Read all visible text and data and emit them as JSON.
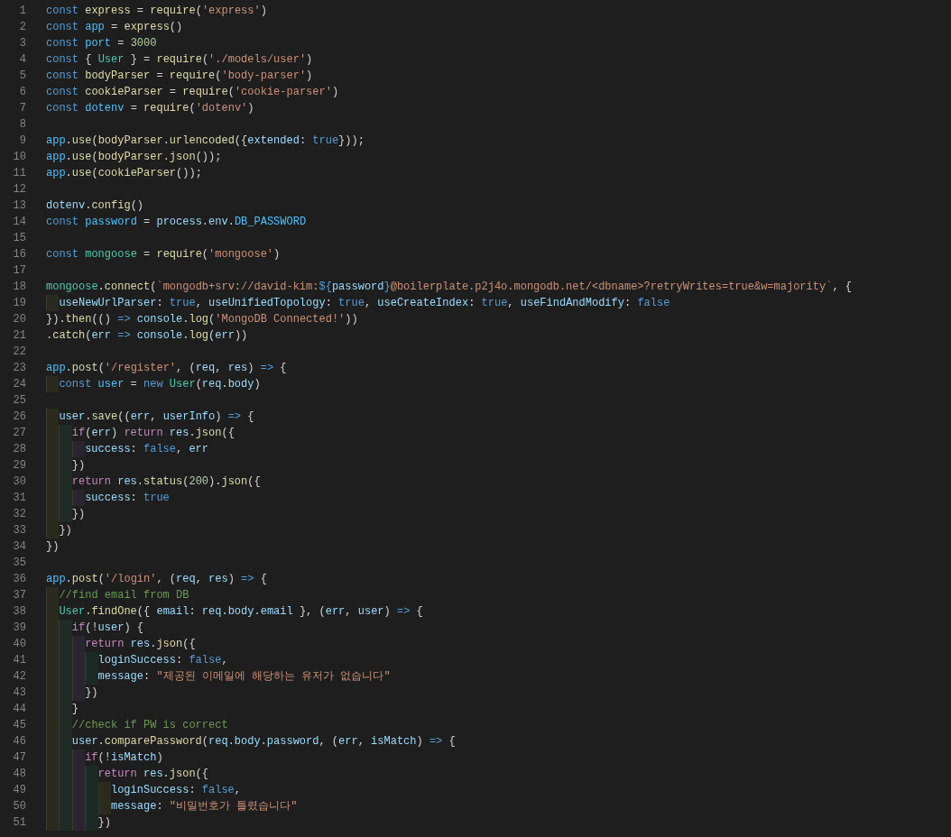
{
  "editor": {
    "lines": [
      {
        "number": "1",
        "tokens": [
          {
            "kind": "keyword",
            "text": "const "
          },
          {
            "kind": "function",
            "text": "express"
          },
          {
            "kind": "punct",
            "text": " = "
          },
          {
            "kind": "function",
            "text": "require"
          },
          {
            "kind": "punct",
            "text": "("
          },
          {
            "kind": "string",
            "text": "'express'"
          },
          {
            "kind": "punct",
            "text": ")"
          }
        ]
      },
      {
        "number": "2",
        "tokens": [
          {
            "kind": "keyword",
            "text": "const "
          },
          {
            "kind": "constant",
            "text": "app"
          },
          {
            "kind": "punct",
            "text": " = "
          },
          {
            "kind": "function",
            "text": "express"
          },
          {
            "kind": "punct",
            "text": "()"
          }
        ]
      },
      {
        "number": "3",
        "tokens": [
          {
            "kind": "keyword",
            "text": "const "
          },
          {
            "kind": "constant",
            "text": "port"
          },
          {
            "kind": "punct",
            "text": " = "
          },
          {
            "kind": "number",
            "text": "3000"
          }
        ]
      },
      {
        "number": "4",
        "tokens": [
          {
            "kind": "keyword",
            "text": "const"
          },
          {
            "kind": "punct",
            "text": " { "
          },
          {
            "kind": "type",
            "text": "User"
          },
          {
            "kind": "punct",
            "text": " } = "
          },
          {
            "kind": "function",
            "text": "require"
          },
          {
            "kind": "punct",
            "text": "("
          },
          {
            "kind": "string",
            "text": "'./models/user'"
          },
          {
            "kind": "punct",
            "text": ")"
          }
        ]
      },
      {
        "number": "5",
        "tokens": [
          {
            "kind": "keyword",
            "text": "const "
          },
          {
            "kind": "function",
            "text": "bodyParser"
          },
          {
            "kind": "punct",
            "text": " = "
          },
          {
            "kind": "function",
            "text": "require"
          },
          {
            "kind": "punct",
            "text": "("
          },
          {
            "kind": "string",
            "text": "'body-parser'"
          },
          {
            "kind": "punct",
            "text": ")"
          }
        ]
      },
      {
        "number": "6",
        "tokens": [
          {
            "kind": "keyword",
            "text": "const "
          },
          {
            "kind": "function",
            "text": "cookieParser"
          },
          {
            "kind": "punct",
            "text": " = "
          },
          {
            "kind": "function",
            "text": "require"
          },
          {
            "kind": "punct",
            "text": "("
          },
          {
            "kind": "string",
            "text": "'cookie-parser'"
          },
          {
            "kind": "punct",
            "text": ")"
          }
        ]
      },
      {
        "number": "7",
        "tokens": [
          {
            "kind": "keyword",
            "text": "const "
          },
          {
            "kind": "constant",
            "text": "dotenv"
          },
          {
            "kind": "punct",
            "text": " = "
          },
          {
            "kind": "function",
            "text": "require"
          },
          {
            "kind": "punct",
            "text": "("
          },
          {
            "kind": "string",
            "text": "'dotenv'"
          },
          {
            "kind": "punct",
            "text": ")"
          }
        ]
      },
      {
        "number": "8"
      },
      {
        "number": "9",
        "tokens": [
          {
            "kind": "constant",
            "text": "app"
          },
          {
            "kind": "punct",
            "text": "."
          },
          {
            "kind": "function",
            "text": "use"
          },
          {
            "kind": "punct",
            "text": "("
          },
          {
            "kind": "function",
            "text": "bodyParser"
          },
          {
            "kind": "punct",
            "text": "."
          },
          {
            "kind": "function",
            "text": "urlencoded"
          },
          {
            "kind": "punct",
            "text": "({"
          },
          {
            "kind": "variable",
            "text": "extended"
          },
          {
            "kind": "punct",
            "text": ": "
          },
          {
            "kind": "keyword",
            "text": "true"
          },
          {
            "kind": "punct",
            "text": "}));"
          }
        ]
      },
      {
        "number": "10",
        "tokens": [
          {
            "kind": "constant",
            "text": "app"
          },
          {
            "kind": "punct",
            "text": "."
          },
          {
            "kind": "function",
            "text": "use"
          },
          {
            "kind": "punct",
            "text": "("
          },
          {
            "kind": "function",
            "text": "bodyParser"
          },
          {
            "kind": "punct",
            "text": "."
          },
          {
            "kind": "function",
            "text": "json"
          },
          {
            "kind": "punct",
            "text": "());"
          }
        ]
      },
      {
        "number": "11",
        "tokens": [
          {
            "kind": "constant",
            "text": "app"
          },
          {
            "kind": "punct",
            "text": "."
          },
          {
            "kind": "function",
            "text": "use"
          },
          {
            "kind": "punct",
            "text": "("
          },
          {
            "kind": "function",
            "text": "cookieParser"
          },
          {
            "kind": "punct",
            "text": "());"
          }
        ]
      },
      {
        "number": "12"
      },
      {
        "number": "13",
        "tokens": [
          {
            "kind": "variable",
            "text": "dotenv"
          },
          {
            "kind": "punct",
            "text": "."
          },
          {
            "kind": "function",
            "text": "config"
          },
          {
            "kind": "punct",
            "text": "()"
          }
        ]
      },
      {
        "number": "14",
        "tokens": [
          {
            "kind": "keyword",
            "text": "const "
          },
          {
            "kind": "constant",
            "text": "password"
          },
          {
            "kind": "punct",
            "text": " = "
          },
          {
            "kind": "variable",
            "text": "process"
          },
          {
            "kind": "punct",
            "text": "."
          },
          {
            "kind": "variable",
            "text": "env"
          },
          {
            "kind": "punct",
            "text": "."
          },
          {
            "kind": "constant",
            "text": "DB_PASSWORD"
          }
        ]
      },
      {
        "number": "15"
      },
      {
        "number": "16",
        "tokens": [
          {
            "kind": "keyword",
            "text": "const "
          },
          {
            "kind": "type",
            "text": "mongoose"
          },
          {
            "kind": "punct",
            "text": " = "
          },
          {
            "kind": "function",
            "text": "require"
          },
          {
            "kind": "punct",
            "text": "("
          },
          {
            "kind": "string",
            "text": "'mongoose'"
          },
          {
            "kind": "punct",
            "text": ")"
          }
        ]
      },
      {
        "number": "17"
      },
      {
        "number": "18",
        "tokens": [
          {
            "kind": "type",
            "text": "mongoose"
          },
          {
            "kind": "punct",
            "text": "."
          },
          {
            "kind": "function",
            "text": "connect"
          },
          {
            "kind": "punct",
            "text": "("
          },
          {
            "kind": "string",
            "text": "`mongodb+srv://david-kim:"
          },
          {
            "kind": "keyword",
            "text": "${"
          },
          {
            "kind": "variable",
            "text": "password"
          },
          {
            "kind": "keyword",
            "text": "}"
          },
          {
            "kind": "string",
            "text": "@boilerplate.p2j4o.mongodb.net/<dbname>?retryWrites=true&w=majority`"
          },
          {
            "kind": "punct",
            "text": ", {"
          }
        ]
      },
      {
        "number": "19",
        "tokens": [
          {
            "kind": "variable",
            "text": "  useNewUrlParser"
          },
          {
            "kind": "punct",
            "text": ": "
          },
          {
            "kind": "keyword",
            "text": "true"
          },
          {
            "kind": "punct",
            "text": ", "
          },
          {
            "kind": "variable",
            "text": "useUnifiedTopology"
          },
          {
            "kind": "punct",
            "text": ": "
          },
          {
            "kind": "keyword",
            "text": "true"
          },
          {
            "kind": "punct",
            "text": ", "
          },
          {
            "kind": "variable",
            "text": "useCreateIndex"
          },
          {
            "kind": "punct",
            "text": ": "
          },
          {
            "kind": "keyword",
            "text": "true"
          },
          {
            "kind": "punct",
            "text": ", "
          },
          {
            "kind": "variable",
            "text": "useFindAndModify"
          },
          {
            "kind": "punct",
            "text": ": "
          },
          {
            "kind": "keyword",
            "text": "false"
          }
        ]
      },
      {
        "number": "20",
        "tokens": [
          {
            "kind": "punct",
            "text": "})."
          },
          {
            "kind": "function",
            "text": "then"
          },
          {
            "kind": "punct",
            "text": "(() "
          },
          {
            "kind": "keyword",
            "text": "=> "
          },
          {
            "kind": "variable",
            "text": "console"
          },
          {
            "kind": "punct",
            "text": "."
          },
          {
            "kind": "function",
            "text": "log"
          },
          {
            "kind": "punct",
            "text": "("
          },
          {
            "kind": "string",
            "text": "'MongoDB Connected!'"
          },
          {
            "kind": "punct",
            "text": "))"
          }
        ]
      },
      {
        "number": "21",
        "tokens": [
          {
            "kind": "punct",
            "text": "."
          },
          {
            "kind": "function",
            "text": "catch"
          },
          {
            "kind": "punct",
            "text": "("
          },
          {
            "kind": "variable",
            "text": "err "
          },
          {
            "kind": "keyword",
            "text": "=> "
          },
          {
            "kind": "variable",
            "text": "console"
          },
          {
            "kind": "punct",
            "text": "."
          },
          {
            "kind": "function",
            "text": "log"
          },
          {
            "kind": "punct",
            "text": "("
          },
          {
            "kind": "variable",
            "text": "err"
          },
          {
            "kind": "punct",
            "text": "))"
          }
        ]
      },
      {
        "number": "22"
      },
      {
        "number": "23",
        "tokens": [
          {
            "kind": "constant",
            "text": "app"
          },
          {
            "kind": "punct",
            "text": "."
          },
          {
            "kind": "function",
            "text": "post"
          },
          {
            "kind": "punct",
            "text": "("
          },
          {
            "kind": "string",
            "text": "'/register'"
          },
          {
            "kind": "punct",
            "text": ", ("
          },
          {
            "kind": "variable",
            "text": "req"
          },
          {
            "kind": "punct",
            "text": ", "
          },
          {
            "kind": "variable",
            "text": "res"
          },
          {
            "kind": "punct",
            "text": ") "
          },
          {
            "kind": "keyword",
            "text": "=>"
          },
          {
            "kind": "punct",
            "text": " {"
          }
        ]
      },
      {
        "number": "24",
        "tokens": [
          {
            "kind": "keyword",
            "text": "  const "
          },
          {
            "kind": "constant",
            "text": "user"
          },
          {
            "kind": "punct",
            "text": " = "
          },
          {
            "kind": "keyword",
            "text": "new "
          },
          {
            "kind": "type",
            "text": "User"
          },
          {
            "kind": "punct",
            "text": "("
          },
          {
            "kind": "variable",
            "text": "req"
          },
          {
            "kind": "punct",
            "text": "."
          },
          {
            "kind": "variable",
            "text": "body"
          },
          {
            "kind": "punct",
            "text": ")"
          }
        ]
      },
      {
        "number": "25"
      },
      {
        "number": "26",
        "tokens": [
          {
            "kind": "variable",
            "text": "  user"
          },
          {
            "kind": "punct",
            "text": "."
          },
          {
            "kind": "function",
            "text": "save"
          },
          {
            "kind": "punct",
            "text": "(("
          },
          {
            "kind": "variable",
            "text": "err"
          },
          {
            "kind": "punct",
            "text": ", "
          },
          {
            "kind": "variable",
            "text": "userInfo"
          },
          {
            "kind": "punct",
            "text": ") "
          },
          {
            "kind": "keyword",
            "text": "=>"
          },
          {
            "kind": "punct",
            "text": " {"
          }
        ]
      },
      {
        "number": "27",
        "tokens": [
          {
            "kind": "control",
            "text": "    if"
          },
          {
            "kind": "punct",
            "text": "("
          },
          {
            "kind": "variable",
            "text": "err"
          },
          {
            "kind": "punct",
            "text": ") "
          },
          {
            "kind": "control",
            "text": "return "
          },
          {
            "kind": "variable",
            "text": "res"
          },
          {
            "kind": "punct",
            "text": "."
          },
          {
            "kind": "function",
            "text": "json"
          },
          {
            "kind": "punct",
            "text": "({"
          }
        ]
      },
      {
        "number": "28",
        "tokens": [
          {
            "kind": "variable",
            "text": "      success"
          },
          {
            "kind": "punct",
            "text": ": "
          },
          {
            "kind": "keyword",
            "text": "false"
          },
          {
            "kind": "punct",
            "text": ", "
          },
          {
            "kind": "variable",
            "text": "err"
          }
        ]
      },
      {
        "number": "29",
        "tokens": [
          {
            "kind": "punct",
            "text": "    })"
          }
        ]
      },
      {
        "number": "30",
        "tokens": [
          {
            "kind": "control",
            "text": "    return "
          },
          {
            "kind": "variable",
            "text": "res"
          },
          {
            "kind": "punct",
            "text": "."
          },
          {
            "kind": "function",
            "text": "status"
          },
          {
            "kind": "punct",
            "text": "("
          },
          {
            "kind": "number",
            "text": "200"
          },
          {
            "kind": "punct",
            "text": ")."
          },
          {
            "kind": "function",
            "text": "json"
          },
          {
            "kind": "punct",
            "text": "({"
          }
        ]
      },
      {
        "number": "31",
        "tokens": [
          {
            "kind": "variable",
            "text": "      success"
          },
          {
            "kind": "punct",
            "text": ": "
          },
          {
            "kind": "keyword",
            "text": "true"
          }
        ]
      },
      {
        "number": "32",
        "tokens": [
          {
            "kind": "punct",
            "text": "    })"
          }
        ]
      },
      {
        "number": "33",
        "tokens": [
          {
            "kind": "punct",
            "text": "  })"
          }
        ]
      },
      {
        "number": "34",
        "tokens": [
          {
            "kind": "punct",
            "text": "})"
          }
        ]
      },
      {
        "number": "35"
      },
      {
        "number": "36",
        "tokens": [
          {
            "kind": "constant",
            "text": "app"
          },
          {
            "kind": "punct",
            "text": "."
          },
          {
            "kind": "function",
            "text": "post"
          },
          {
            "kind": "punct",
            "text": "("
          },
          {
            "kind": "string",
            "text": "'/login'"
          },
          {
            "kind": "punct",
            "text": ", ("
          },
          {
            "kind": "variable",
            "text": "req"
          },
          {
            "kind": "punct",
            "text": ", "
          },
          {
            "kind": "variable",
            "text": "res"
          },
          {
            "kind": "punct",
            "text": ") "
          },
          {
            "kind": "keyword",
            "text": "=>"
          },
          {
            "kind": "punct",
            "text": " {"
          }
        ]
      },
      {
        "number": "37",
        "tokens": [
          {
            "kind": "comment",
            "text": "  //find email from DB"
          }
        ]
      },
      {
        "number": "38",
        "tokens": [
          {
            "kind": "type",
            "text": "  User"
          },
          {
            "kind": "punct",
            "text": "."
          },
          {
            "kind": "function",
            "text": "findOne"
          },
          {
            "kind": "punct",
            "text": "({ "
          },
          {
            "kind": "variable",
            "text": "email"
          },
          {
            "kind": "punct",
            "text": ": "
          },
          {
            "kind": "variable",
            "text": "req"
          },
          {
            "kind": "punct",
            "text": "."
          },
          {
            "kind": "variable",
            "text": "body"
          },
          {
            "kind": "punct",
            "text": "."
          },
          {
            "kind": "variable",
            "text": "email"
          },
          {
            "kind": "punct",
            "text": " }, ("
          },
          {
            "kind": "variable",
            "text": "err"
          },
          {
            "kind": "punct",
            "text": ", "
          },
          {
            "kind": "variable",
            "text": "user"
          },
          {
            "kind": "punct",
            "text": ") "
          },
          {
            "kind": "keyword",
            "text": "=>"
          },
          {
            "kind": "punct",
            "text": " {"
          }
        ]
      },
      {
        "number": "39",
        "tokens": [
          {
            "kind": "control",
            "text": "    if"
          },
          {
            "kind": "punct",
            "text": "(!"
          },
          {
            "kind": "variable",
            "text": "user"
          },
          {
            "kind": "punct",
            "text": ") {"
          }
        ]
      },
      {
        "number": "40",
        "tokens": [
          {
            "kind": "control",
            "text": "      return "
          },
          {
            "kind": "variable",
            "text": "res"
          },
          {
            "kind": "punct",
            "text": "."
          },
          {
            "kind": "function",
            "text": "json"
          },
          {
            "kind": "punct",
            "text": "({"
          }
        ]
      },
      {
        "number": "41",
        "tokens": [
          {
            "kind": "variable",
            "text": "        loginSuccess"
          },
          {
            "kind": "punct",
            "text": ": "
          },
          {
            "kind": "keyword",
            "text": "false"
          },
          {
            "kind": "punct",
            "text": ","
          }
        ]
      },
      {
        "number": "42",
        "tokens": [
          {
            "kind": "variable",
            "text": "        message"
          },
          {
            "kind": "punct",
            "text": ": "
          },
          {
            "kind": "string",
            "text": "\"제공된 이메일에 해당하는 유저가 없습니다\""
          }
        ]
      },
      {
        "number": "43",
        "tokens": [
          {
            "kind": "punct",
            "text": "      })"
          }
        ]
      },
      {
        "number": "44",
        "tokens": [
          {
            "kind": "punct",
            "text": "    }"
          }
        ]
      },
      {
        "number": "45",
        "tokens": [
          {
            "kind": "comment",
            "text": "    //check if PW is correct"
          }
        ]
      },
      {
        "number": "46",
        "tokens": [
          {
            "kind": "variable",
            "text": "    user"
          },
          {
            "kind": "punct",
            "text": "."
          },
          {
            "kind": "function",
            "text": "comparePassword"
          },
          {
            "kind": "punct",
            "text": "("
          },
          {
            "kind": "variable",
            "text": "req"
          },
          {
            "kind": "punct",
            "text": "."
          },
          {
            "kind": "variable",
            "text": "body"
          },
          {
            "kind": "punct",
            "text": "."
          },
          {
            "kind": "variable",
            "text": "password"
          },
          {
            "kind": "punct",
            "text": ", ("
          },
          {
            "kind": "variable",
            "text": "err"
          },
          {
            "kind": "punct",
            "text": ", "
          },
          {
            "kind": "variable",
            "text": "isMatch"
          },
          {
            "kind": "punct",
            "text": ") "
          },
          {
            "kind": "keyword",
            "text": "=>"
          },
          {
            "kind": "punct",
            "text": " {"
          }
        ]
      },
      {
        "number": "47",
        "tokens": [
          {
            "kind": "control",
            "text": "      if"
          },
          {
            "kind": "punct",
            "text": "(!"
          },
          {
            "kind": "variable",
            "text": "isMatch"
          },
          {
            "kind": "punct",
            "text": ")"
          }
        ]
      },
      {
        "number": "48",
        "tokens": [
          {
            "kind": "control",
            "text": "        return "
          },
          {
            "kind": "variable",
            "text": "res"
          },
          {
            "kind": "punct",
            "text": "."
          },
          {
            "kind": "function",
            "text": "json"
          },
          {
            "kind": "punct",
            "text": "({"
          }
        ]
      },
      {
        "number": "49",
        "tokens": [
          {
            "kind": "variable",
            "text": "          loginSuccess"
          },
          {
            "kind": "punct",
            "text": ": "
          },
          {
            "kind": "keyword",
            "text": "false"
          },
          {
            "kind": "punct",
            "text": ","
          }
        ]
      },
      {
        "number": "50",
        "tokens": [
          {
            "kind": "variable",
            "text": "          message"
          },
          {
            "kind": "punct",
            "text": ": "
          },
          {
            "kind": "string",
            "text": "\"비밀번호가 틀렸습니다\""
          }
        ]
      },
      {
        "number": "51",
        "tokens": [
          {
            "kind": "punct",
            "text": "        })"
          }
        ]
      }
    ]
  }
}
